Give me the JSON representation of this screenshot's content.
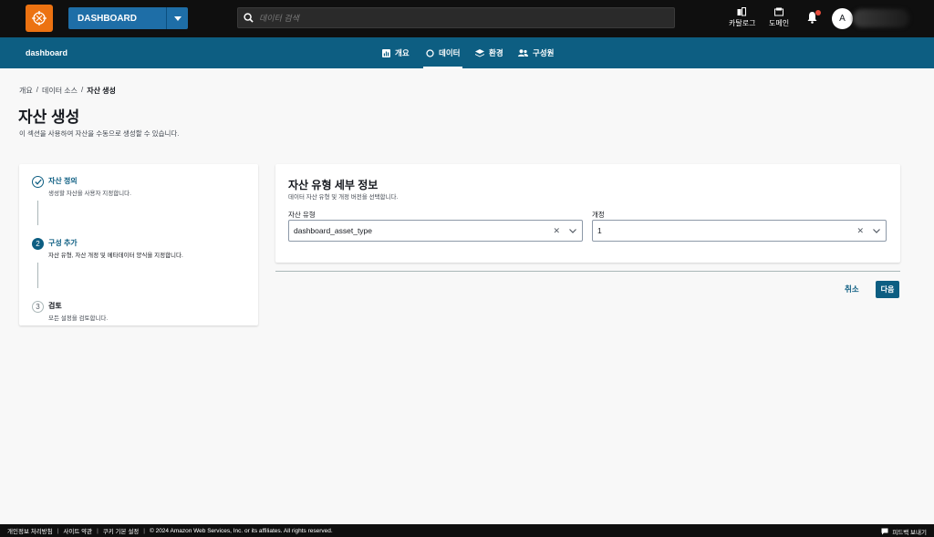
{
  "header": {
    "project_label": "DASHBOARD",
    "search_placeholder": "데이터 검색",
    "catalog_label": "카탈로그",
    "domain_label": "도메인",
    "avatar_initial": "A"
  },
  "subnav": {
    "title": "dashboard",
    "tabs": [
      {
        "label": "개요",
        "icon": "chart-icon"
      },
      {
        "label": "데이터",
        "icon": "circle-icon",
        "active": true
      },
      {
        "label": "환경",
        "icon": "layers-icon"
      },
      {
        "label": "구성원",
        "icon": "people-icon"
      }
    ]
  },
  "breadcrumb": {
    "items": [
      "개요",
      "데이터 소스",
      "자산 생성"
    ],
    "separator": "/"
  },
  "page": {
    "title": "자산 생성",
    "description": "이 섹션을 사용하여 자산을 수동으로 생성할 수 있습니다."
  },
  "steps": [
    {
      "number": "1",
      "title": "자산 정의",
      "desc": "생성할 자산을 사용자 지정합니다.",
      "state": "complete"
    },
    {
      "number": "2",
      "title": "구성 추가",
      "desc": "자산 유형, 자산 개정 및 메타데이터 양식을 지정합니다.",
      "state": "current"
    },
    {
      "number": "3",
      "title": "검토",
      "desc": "모든 설정을 검토합니다.",
      "state": "pending"
    }
  ],
  "detail": {
    "title": "자산 유형 세부 정보",
    "description": "데이터 자산 유형 및 개정 버전을 선택합니다.",
    "asset_type_label": "자산 유형",
    "asset_type_value": "dashboard_asset_type",
    "revision_label": "개정",
    "revision_value": "1"
  },
  "actions": {
    "cancel": "취소",
    "next": "다음"
  },
  "footer": {
    "links": [
      "개인정보 처리방침",
      "사이트 약관",
      "쿠키 기본 설정"
    ],
    "copyright": "© 2024 Amazon Web Services, Inc. or its affiliates. All rights reserved.",
    "feedback": "피드백 보내기"
  },
  "colors": {
    "accent": "#0d5e82",
    "logo": "#ec7211",
    "header_bg": "#0f0f0f"
  }
}
